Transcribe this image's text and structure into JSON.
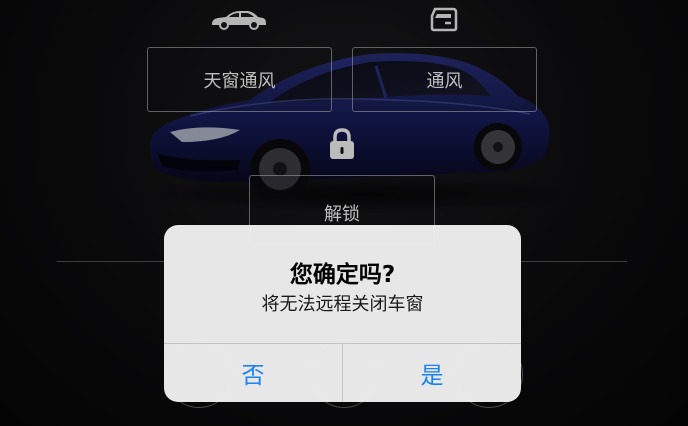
{
  "controls": {
    "sunroof_vent_label": "天窗通风",
    "vent_label": "通风",
    "unlock_label": "解锁"
  },
  "icons": {
    "car": "car-icon",
    "window": "window-icon",
    "lock": "lock-icon"
  },
  "alert": {
    "title": "您确定吗?",
    "message": "将无法远程关闭车窗",
    "cancel_label": "否",
    "confirm_label": "是"
  },
  "colors": {
    "accent": "#1a82f7",
    "car_body": "#141a52",
    "background": "#0a0a0a"
  }
}
